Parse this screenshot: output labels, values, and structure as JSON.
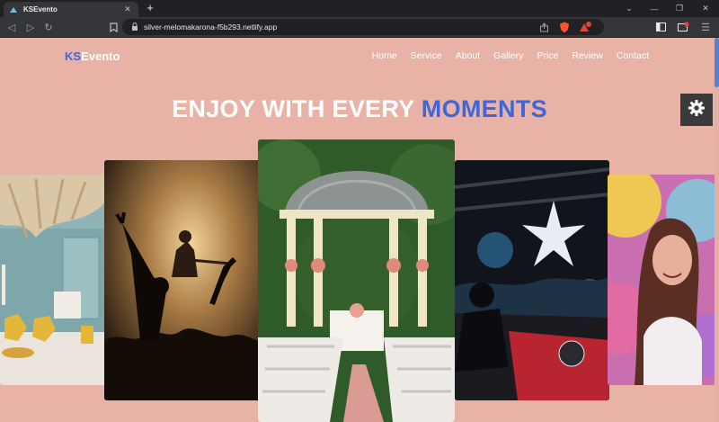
{
  "browser": {
    "tab_title": "KSEvento",
    "url": "silver-melomakarona-f5b293.netlify.app",
    "extension_badge": "1"
  },
  "site": {
    "logo_ks": "KS",
    "logo_evento": "Evento",
    "nav": [
      "Home",
      "Service",
      "About",
      "Gallery",
      "Price",
      "Review",
      "Contact"
    ],
    "headline_white": "ENJOY WITH EVERY",
    "headline_blue": "MOMENTS"
  },
  "colors": {
    "background": "#e8b3a6",
    "accent": "#3f66d8"
  },
  "gallery": [
    "party-decor-photo",
    "concert-crowd-photo",
    "wedding-gazebo-photo",
    "dj-club-photo",
    "color-festival-photo"
  ]
}
